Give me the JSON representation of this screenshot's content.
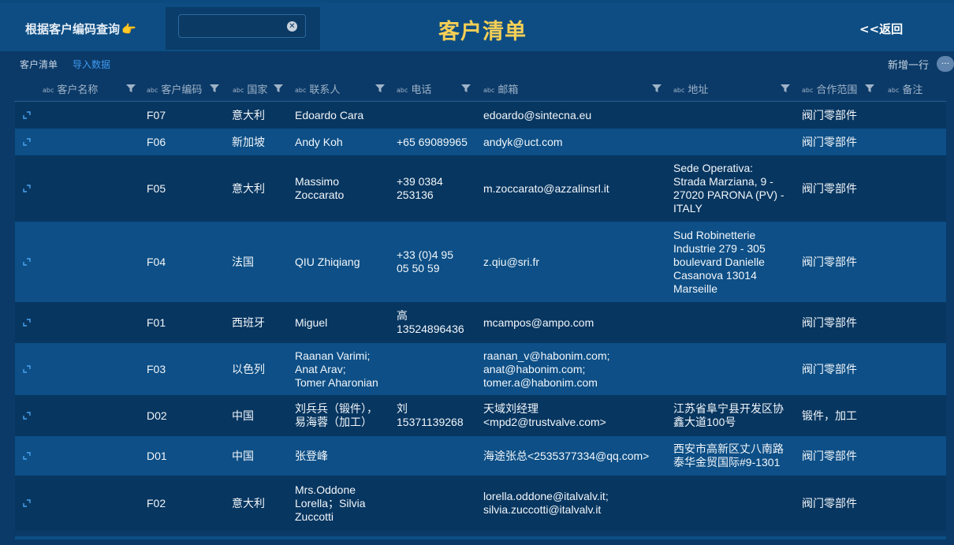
{
  "header": {
    "query_label": "根据客户编码查询",
    "query_icon": "👉",
    "search_value": "",
    "title": "客户清单",
    "back_label": "<<返回"
  },
  "subbar": {
    "tab_list": "客户清单",
    "tab_import": "导入数据",
    "add_row": "新增一行",
    "add_icon_glyph": "···"
  },
  "columns": [
    {
      "label": "客户名称"
    },
    {
      "label": "客户编码"
    },
    {
      "label": "国家"
    },
    {
      "label": "联系人"
    },
    {
      "label": "电话"
    },
    {
      "label": "邮箱"
    },
    {
      "label": "地址"
    },
    {
      "label": "合作范围"
    },
    {
      "label": "备注"
    }
  ],
  "col_type_tag": "abc",
  "rows": [
    {
      "code": "F07",
      "country": "意大利",
      "contact": "Edoardo Cara",
      "phone": "",
      "email": "edoardo@sintecna.eu",
      "address": "",
      "scope": "阀门零部件",
      "note": ""
    },
    {
      "code": "F06",
      "country": "新加坡",
      "contact": "Andy Koh",
      "phone": "+65 69089965",
      "email": "andyk@uct.com",
      "address": "",
      "scope": "阀门零部件",
      "note": ""
    },
    {
      "code": "F05",
      "country": "意大利",
      "contact": "Massimo\nZoccarato",
      "phone": "+39 0384\n253136",
      "email": "m.zoccarato@azzalinsrl.it",
      "address": "Sede Operativa:\nStrada Marziana, 9 -\n27020 PARONA (PV) -\nITALY",
      "scope": "阀门零部件",
      "note": ""
    },
    {
      "code": "F04",
      "country": "法国",
      "contact": "QIU Zhiqiang",
      "phone": "+33 (0)4 95\n05 50 59",
      "email": "z.qiu@sri.fr",
      "address": "Sud Robinetterie\nIndustrie 279 - 305\nboulevard Danielle\nCasanova 13014\nMarseille",
      "scope": "阀门零部件",
      "note": ""
    },
    {
      "code": "F01",
      "country": "西班牙",
      "contact": "Miguel",
      "phone": "高\n13524896436",
      "email": "mcampos@ampo.com",
      "address": "",
      "scope": "阀门零部件",
      "note": ""
    },
    {
      "code": "F03",
      "country": "以色列",
      "contact": "Raanan Varimi;\nAnat Arav;\nTomer Aharonian",
      "phone": "",
      "email": "raanan_v@habonim.com;\nanat@habonim.com;\ntomer.a@habonim.com",
      "address": "",
      "scope": "阀门零部件",
      "note": ""
    },
    {
      "code": "D02",
      "country": "中国",
      "contact": "刘兵兵（锻件），\n易海蓉（加工）",
      "phone": "刘\n15371139268",
      "email": "天域刘经理\n<mpd2@trustvalve.com>",
      "address": "江苏省阜宁县开发区协\n鑫大道100号",
      "scope": "锻件，加工",
      "note": ""
    },
    {
      "code": "D01",
      "country": "中国",
      "contact": "张登峰",
      "phone": "",
      "email": "海途张总<2535377334@qq.com>",
      "address": "西安市高新区丈八南路\n泰华金贸国际#9-1301",
      "scope": "阀门零部件",
      "note": ""
    },
    {
      "code": "F02",
      "country": "意大利",
      "contact": "Mrs.Oddone\nLorella；Silvia\nZuccotti",
      "phone": "",
      "email": "lorella.oddone@italvalv.it;\nsilvia.zuccotti@italvalv.it",
      "address": "",
      "scope": "阀门零部件",
      "note": ""
    }
  ],
  "colors": {
    "background": "#0b3a68",
    "header": "#0d4d83",
    "title": "#f6cf56",
    "row_dark": "#073660",
    "row_light": "#0d4f86",
    "link": "#3f9bf0"
  }
}
